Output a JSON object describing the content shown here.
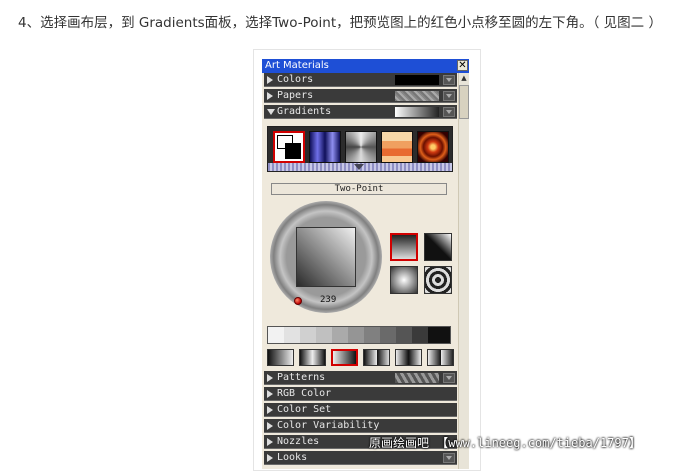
{
  "instruction": "4、选择画布层，到 Gradients面板，选择Two-Point，把预览图上的红色小点移至圆的左下角。（ 见图二 ）",
  "panel": {
    "title": "Art Materials",
    "close_glyph": "✕",
    "sections_top": [
      {
        "label": "Colors",
        "open": false
      },
      {
        "label": "Papers",
        "open": false
      },
      {
        "label": "Gradients",
        "open": true
      }
    ],
    "gradient_name": "Two-Point",
    "angle": "239",
    "sections_bottom": [
      {
        "label": "Patterns"
      },
      {
        "label": "RGB Color"
      },
      {
        "label": "Color Set"
      },
      {
        "label": "Color Variability"
      },
      {
        "label": "Nozzles"
      },
      {
        "label": "Looks"
      }
    ]
  },
  "watermark": "原画绘画吧 【www.lineeg.com/tieba/1797】",
  "colors": {
    "titlebar": "#1e4fd6",
    "selected_border": "#d10000",
    "panel_bg": "#efe9dc",
    "row_bg": "#3a3a3a"
  }
}
